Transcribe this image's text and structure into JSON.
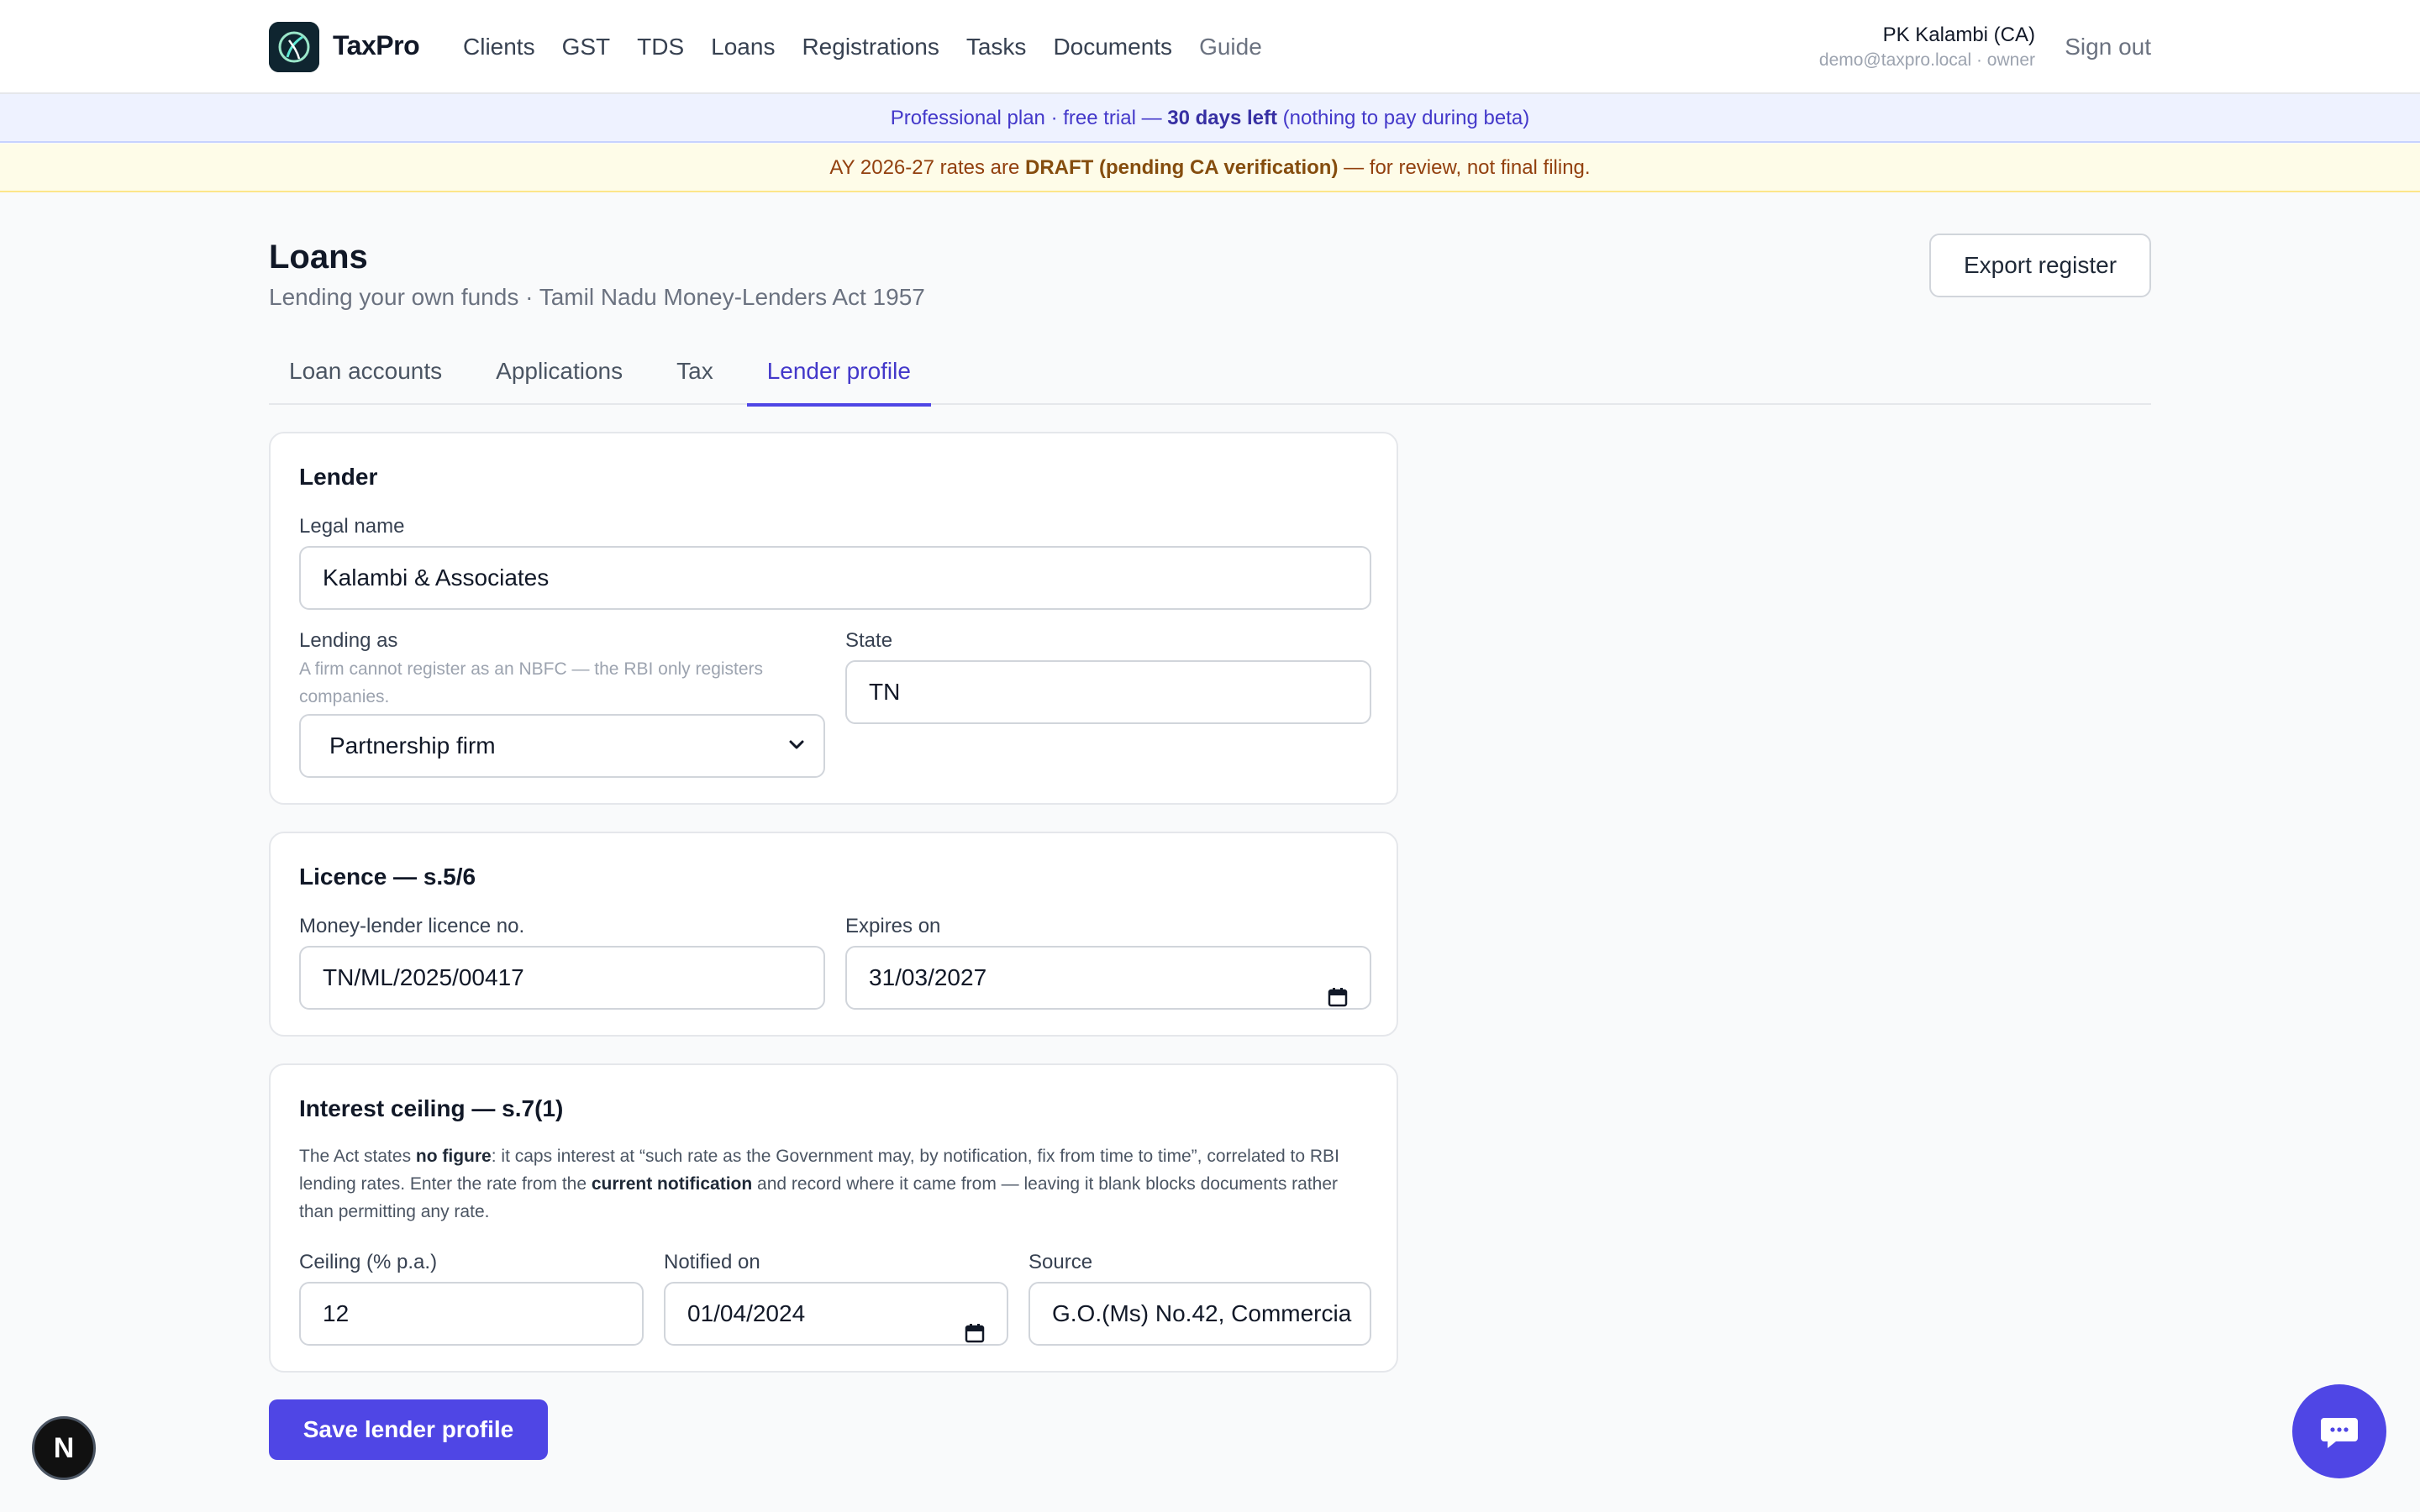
{
  "nav": {
    "brand": "TaxPro",
    "links": [
      "Clients",
      "GST",
      "TDS",
      "Loans",
      "Registrations",
      "Tasks",
      "Documents",
      "Guide"
    ],
    "user_name": "PK Kalambi (CA)",
    "user_meta": "demo@taxpro.local · owner",
    "signout": "Sign out"
  },
  "banners": {
    "trial_prefix": "Professional plan · free trial — ",
    "trial_bold": "30 days left",
    "trial_suffix": " (nothing to pay during beta)",
    "draft_prefix": "AY 2026-27 rates are ",
    "draft_bold": "DRAFT (pending CA verification)",
    "draft_suffix": " — for review, not final filing."
  },
  "page": {
    "title": "Loans",
    "subtitle": "Lending your own funds · Tamil Nadu Money-Lenders Act 1957",
    "export_label": "Export register"
  },
  "tabs": [
    {
      "label": "Loan accounts",
      "active": false
    },
    {
      "label": "Applications",
      "active": false
    },
    {
      "label": "Tax",
      "active": false
    },
    {
      "label": "Lender profile",
      "active": true
    }
  ],
  "lender": {
    "title": "Lender",
    "legal_name_label": "Legal name",
    "legal_name_value": "Kalambi & Associates",
    "lending_as_label": "Lending as",
    "lending_as_hint": "A firm cannot register as an NBFC — the RBI only registers companies.",
    "lending_as_value": "Partnership firm",
    "state_label": "State",
    "state_value": "TN"
  },
  "licence": {
    "title": "Licence — s.5/6",
    "licence_no_label": "Money-lender licence no.",
    "licence_no_value": "TN/ML/2025/00417",
    "expires_label": "Expires on",
    "expires_value": "31/03/2027"
  },
  "ceiling": {
    "title": "Interest ceiling — s.7(1)",
    "notice_1": "The Act states ",
    "notice_b1": "no figure",
    "notice_2": ": it caps interest at “such rate as the Government may, by notification, fix from time to time”, correlated to RBI lending rates. Enter the rate from the ",
    "notice_b2": "current notification",
    "notice_3": " and record where it came from — leaving it blank blocks documents rather than permitting any rate.",
    "ceiling_label": "Ceiling (% p.a.)",
    "ceiling_value": "12",
    "notified_label": "Notified on",
    "notified_value": "01/04/2024",
    "source_label": "Source",
    "source_value": "G.O.(Ms) No.42, Commercia"
  },
  "save_label": "Save lender profile",
  "fab_letter": "N",
  "colors": {
    "accent": "#4f46e5",
    "trial_bg": "#eef2ff",
    "draft_bg": "#fefce8"
  }
}
